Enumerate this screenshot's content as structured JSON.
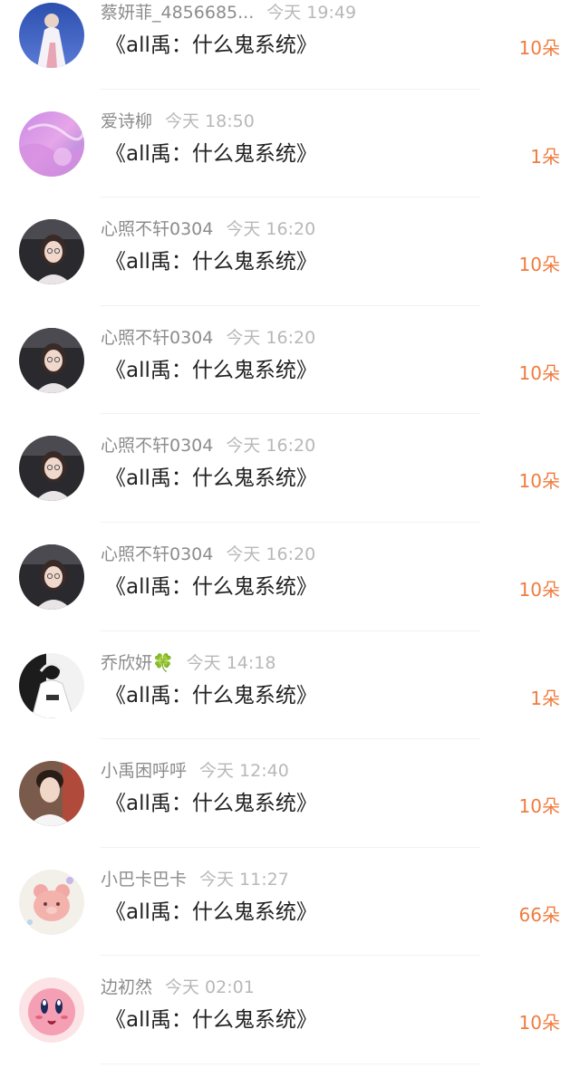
{
  "rows": [
    {
      "name": "蔡妍菲_4856685...",
      "time": "今天 19:49",
      "title": "《all禹：什么鬼系统》",
      "amount": "10朵",
      "avatar": "avatar-white-robe"
    },
    {
      "name": "爱诗柳",
      "time": "今天 18:50",
      "title": "《all禹：什么鬼系统》",
      "amount": "1朵",
      "avatar": "avatar-purple-pink"
    },
    {
      "name": "心照不轩0304",
      "time": "今天 16:20",
      "title": "《all禹：什么鬼系统》",
      "amount": "10朵",
      "avatar": "avatar-girl-car"
    },
    {
      "name": "心照不轩0304",
      "time": "今天 16:20",
      "title": "《all禹：什么鬼系统》",
      "amount": "10朵",
      "avatar": "avatar-girl-car"
    },
    {
      "name": "心照不轩0304",
      "time": "今天 16:20",
      "title": "《all禹：什么鬼系统》",
      "amount": "10朵",
      "avatar": "avatar-girl-car"
    },
    {
      "name": "心照不轩0304",
      "time": "今天 16:20",
      "title": "《all禹：什么鬼系统》",
      "amount": "10朵",
      "avatar": "avatar-girl-car"
    },
    {
      "name": "乔欣妍🍀",
      "time": "今天 14:18",
      "title": "《all禹：什么鬼系统》",
      "amount": "1朵",
      "avatar": "avatar-headphones"
    },
    {
      "name": "小禹困呼呼",
      "time": "今天 12:40",
      "title": "《all禹：什么鬼系统》",
      "amount": "10朵",
      "avatar": "avatar-boy"
    },
    {
      "name": "小巴卡巴卡",
      "time": "今天 11:27",
      "title": "《all禹：什么鬼系统》",
      "amount": "66朵",
      "avatar": "avatar-pink-bear"
    },
    {
      "name": "边初然",
      "time": "今天 02:01",
      "title": "《all禹：什么鬼系统》",
      "amount": "10朵",
      "avatar": "avatar-kirby"
    }
  ],
  "colors": {
    "amount": "#f07c3e",
    "name": "#8c8c8c",
    "time": "#b8b8b8",
    "title": "#222222"
  }
}
